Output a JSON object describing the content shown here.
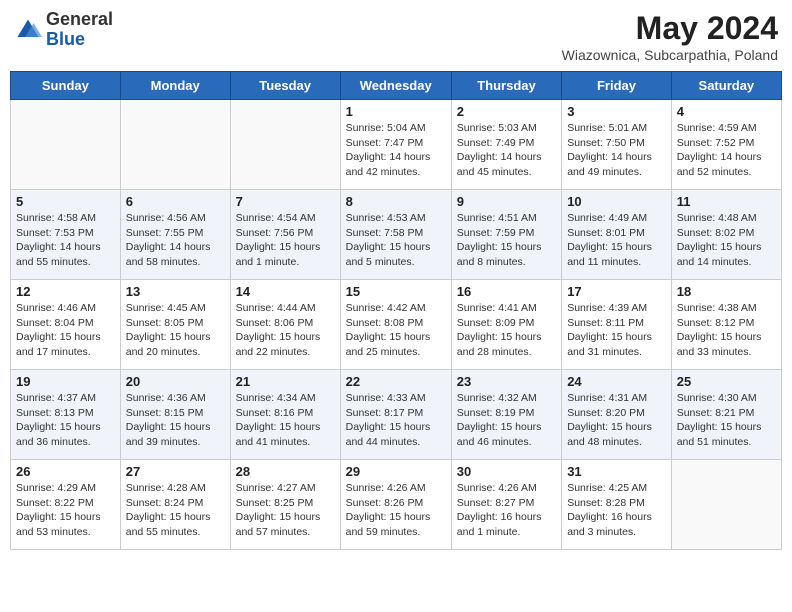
{
  "header": {
    "logo_general": "General",
    "logo_blue": "Blue",
    "month_year": "May 2024",
    "location": "Wiazownica, Subcarpathia, Poland"
  },
  "days_of_week": [
    "Sunday",
    "Monday",
    "Tuesday",
    "Wednesday",
    "Thursday",
    "Friday",
    "Saturday"
  ],
  "weeks": [
    [
      {
        "day": "",
        "info": ""
      },
      {
        "day": "",
        "info": ""
      },
      {
        "day": "",
        "info": ""
      },
      {
        "day": "1",
        "info": "Sunrise: 5:04 AM\nSunset: 7:47 PM\nDaylight: 14 hours\nand 42 minutes."
      },
      {
        "day": "2",
        "info": "Sunrise: 5:03 AM\nSunset: 7:49 PM\nDaylight: 14 hours\nand 45 minutes."
      },
      {
        "day": "3",
        "info": "Sunrise: 5:01 AM\nSunset: 7:50 PM\nDaylight: 14 hours\nand 49 minutes."
      },
      {
        "day": "4",
        "info": "Sunrise: 4:59 AM\nSunset: 7:52 PM\nDaylight: 14 hours\nand 52 minutes."
      }
    ],
    [
      {
        "day": "5",
        "info": "Sunrise: 4:58 AM\nSunset: 7:53 PM\nDaylight: 14 hours\nand 55 minutes."
      },
      {
        "day": "6",
        "info": "Sunrise: 4:56 AM\nSunset: 7:55 PM\nDaylight: 14 hours\nand 58 minutes."
      },
      {
        "day": "7",
        "info": "Sunrise: 4:54 AM\nSunset: 7:56 PM\nDaylight: 15 hours\nand 1 minute."
      },
      {
        "day": "8",
        "info": "Sunrise: 4:53 AM\nSunset: 7:58 PM\nDaylight: 15 hours\nand 5 minutes."
      },
      {
        "day": "9",
        "info": "Sunrise: 4:51 AM\nSunset: 7:59 PM\nDaylight: 15 hours\nand 8 minutes."
      },
      {
        "day": "10",
        "info": "Sunrise: 4:49 AM\nSunset: 8:01 PM\nDaylight: 15 hours\nand 11 minutes."
      },
      {
        "day": "11",
        "info": "Sunrise: 4:48 AM\nSunset: 8:02 PM\nDaylight: 15 hours\nand 14 minutes."
      }
    ],
    [
      {
        "day": "12",
        "info": "Sunrise: 4:46 AM\nSunset: 8:04 PM\nDaylight: 15 hours\nand 17 minutes."
      },
      {
        "day": "13",
        "info": "Sunrise: 4:45 AM\nSunset: 8:05 PM\nDaylight: 15 hours\nand 20 minutes."
      },
      {
        "day": "14",
        "info": "Sunrise: 4:44 AM\nSunset: 8:06 PM\nDaylight: 15 hours\nand 22 minutes."
      },
      {
        "day": "15",
        "info": "Sunrise: 4:42 AM\nSunset: 8:08 PM\nDaylight: 15 hours\nand 25 minutes."
      },
      {
        "day": "16",
        "info": "Sunrise: 4:41 AM\nSunset: 8:09 PM\nDaylight: 15 hours\nand 28 minutes."
      },
      {
        "day": "17",
        "info": "Sunrise: 4:39 AM\nSunset: 8:11 PM\nDaylight: 15 hours\nand 31 minutes."
      },
      {
        "day": "18",
        "info": "Sunrise: 4:38 AM\nSunset: 8:12 PM\nDaylight: 15 hours\nand 33 minutes."
      }
    ],
    [
      {
        "day": "19",
        "info": "Sunrise: 4:37 AM\nSunset: 8:13 PM\nDaylight: 15 hours\nand 36 minutes."
      },
      {
        "day": "20",
        "info": "Sunrise: 4:36 AM\nSunset: 8:15 PM\nDaylight: 15 hours\nand 39 minutes."
      },
      {
        "day": "21",
        "info": "Sunrise: 4:34 AM\nSunset: 8:16 PM\nDaylight: 15 hours\nand 41 minutes."
      },
      {
        "day": "22",
        "info": "Sunrise: 4:33 AM\nSunset: 8:17 PM\nDaylight: 15 hours\nand 44 minutes."
      },
      {
        "day": "23",
        "info": "Sunrise: 4:32 AM\nSunset: 8:19 PM\nDaylight: 15 hours\nand 46 minutes."
      },
      {
        "day": "24",
        "info": "Sunrise: 4:31 AM\nSunset: 8:20 PM\nDaylight: 15 hours\nand 48 minutes."
      },
      {
        "day": "25",
        "info": "Sunrise: 4:30 AM\nSunset: 8:21 PM\nDaylight: 15 hours\nand 51 minutes."
      }
    ],
    [
      {
        "day": "26",
        "info": "Sunrise: 4:29 AM\nSunset: 8:22 PM\nDaylight: 15 hours\nand 53 minutes."
      },
      {
        "day": "27",
        "info": "Sunrise: 4:28 AM\nSunset: 8:24 PM\nDaylight: 15 hours\nand 55 minutes."
      },
      {
        "day": "28",
        "info": "Sunrise: 4:27 AM\nSunset: 8:25 PM\nDaylight: 15 hours\nand 57 minutes."
      },
      {
        "day": "29",
        "info": "Sunrise: 4:26 AM\nSunset: 8:26 PM\nDaylight: 15 hours\nand 59 minutes."
      },
      {
        "day": "30",
        "info": "Sunrise: 4:26 AM\nSunset: 8:27 PM\nDaylight: 16 hours\nand 1 minute."
      },
      {
        "day": "31",
        "info": "Sunrise: 4:25 AM\nSunset: 8:28 PM\nDaylight: 16 hours\nand 3 minutes."
      },
      {
        "day": "",
        "info": ""
      }
    ]
  ]
}
